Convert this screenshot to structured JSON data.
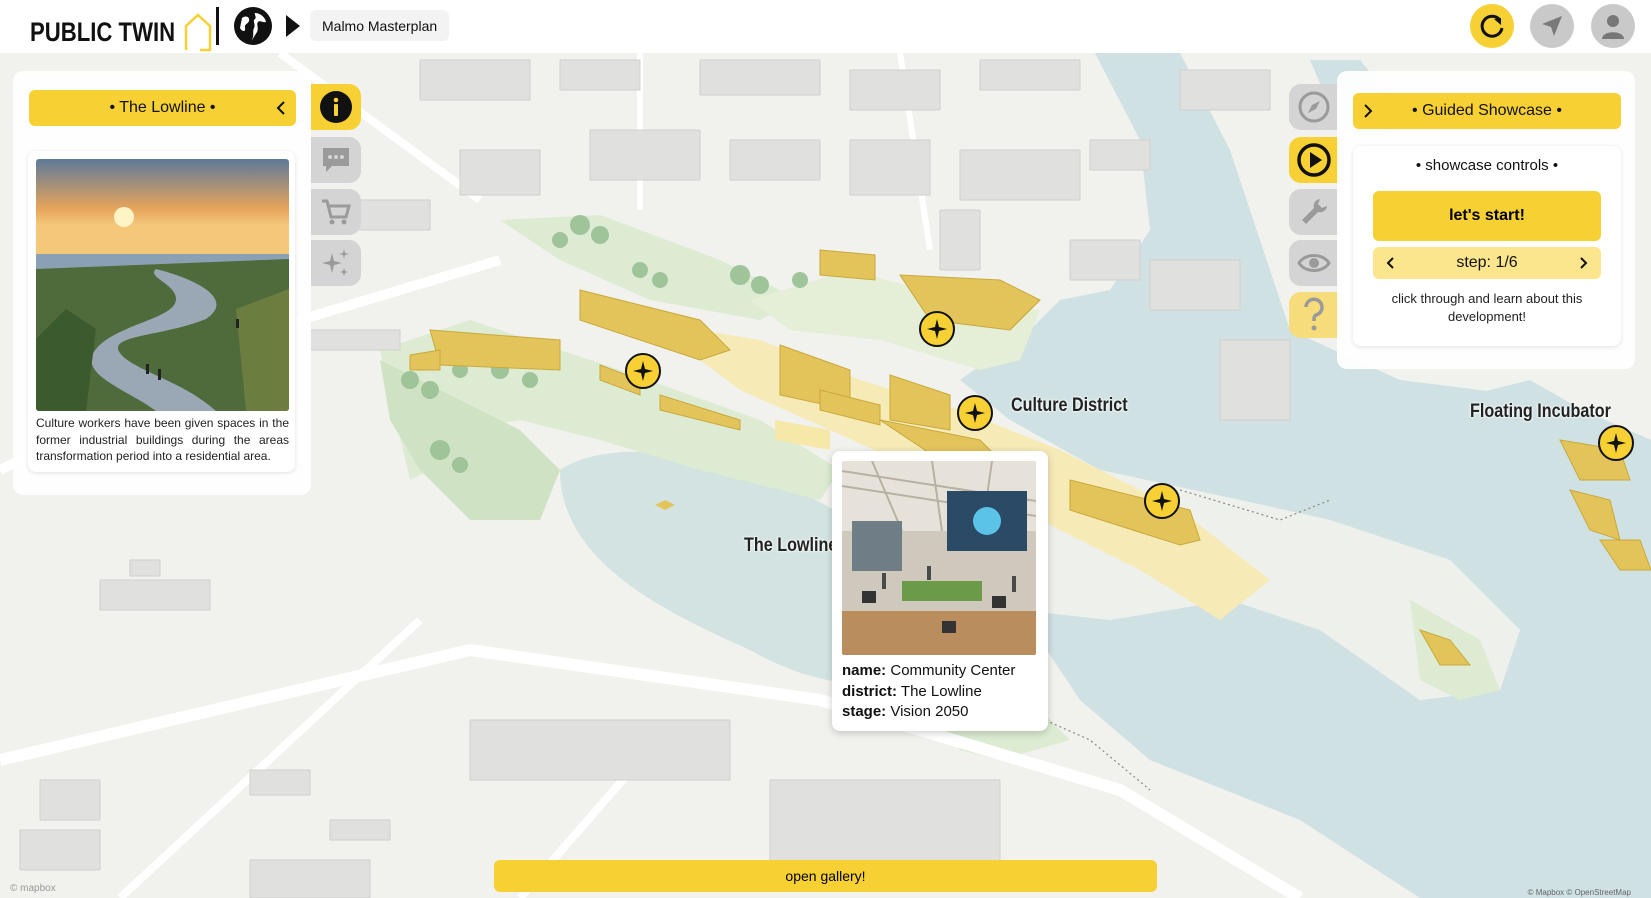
{
  "app": {
    "logo_text": "PUBLIC TWIN",
    "project_name": "Malmo Masterplan",
    "accent_color": "#f7d033"
  },
  "top_actions": [
    {
      "icon": "refresh-icon"
    },
    {
      "icon": "location-arrow-icon"
    },
    {
      "icon": "user-avatar-icon"
    }
  ],
  "left_panel": {
    "title": "• The Lowline •",
    "description": "Culture workers have been given spaces in the former industrial buildings during the areas transformation period into a residential area."
  },
  "left_tabs": [
    {
      "icon": "info-icon"
    },
    {
      "icon": "chat-icon"
    },
    {
      "icon": "cart-icon"
    },
    {
      "icon": "sparkles-icon"
    }
  ],
  "right_tabs": [
    {
      "icon": "compass-icon"
    },
    {
      "icon": "play-circle-icon"
    },
    {
      "icon": "wrench-icon"
    },
    {
      "icon": "eye-icon"
    },
    {
      "icon": "help-icon"
    }
  ],
  "right_panel": {
    "title": "• Guided Showcase •",
    "controls_title": "• showcase controls •",
    "start_label": "let's start!",
    "step_label": "step: 1/6",
    "description": "click through and learn about this development!"
  },
  "map_labels": {
    "culture_district": "Culture District",
    "floating_incubator": "Floating Incubator",
    "lowline": "The Lowline"
  },
  "popup": {
    "name_key": "name:",
    "name_value": "Community Center",
    "district_key": "district:",
    "district_value": "The Lowline",
    "stage_key": "stage:",
    "stage_value": "Vision 2050"
  },
  "gallery_button": "open gallery!",
  "mapbox_logo": "© mapbox",
  "attribution": "© Mapbox © OpenStreetMap"
}
